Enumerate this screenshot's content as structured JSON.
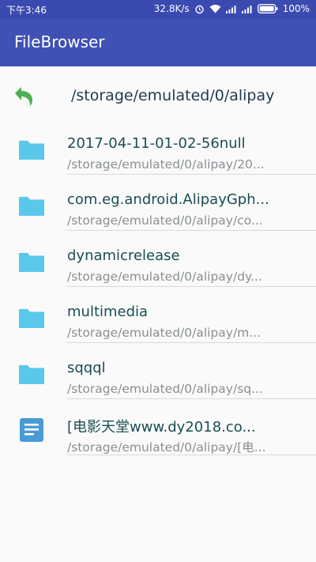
{
  "status_bar": {
    "time": "下午3:46",
    "speed": "32.8K/s",
    "battery": "100%",
    "icons": [
      "alarm-icon",
      "wifi-icon",
      "signal-icon",
      "signal-icon",
      "battery-icon"
    ]
  },
  "app_bar": {
    "title": "FileBrowser",
    "color": "#3f51b5"
  },
  "path_bar": {
    "back_icon": "back-arrow-icon",
    "current_path": "/storage/emulated/0/alipay",
    "back_icon_color": "#4caf50"
  },
  "files": [
    {
      "name": "2017-04-11-01-02-56null",
      "path": "/storage/emulated/0/alipay/20...",
      "type": "folder"
    },
    {
      "name": "com.eg.android.AlipayGph...",
      "path": "/storage/emulated/0/alipay/co...",
      "type": "folder"
    },
    {
      "name": "dynamicrelease",
      "path": "/storage/emulated/0/alipay/dy...",
      "type": "folder"
    },
    {
      "name": "multimedia",
      "path": "/storage/emulated/0/alipay/m...",
      "type": "folder"
    },
    {
      "name": "sqqql",
      "path": "/storage/emulated/0/alipay/sq...",
      "type": "folder"
    },
    {
      "name": "[电影天堂www.dy2018.co...",
      "path": "/storage/emulated/0/alipay/[电...",
      "type": "document"
    }
  ],
  "colors": {
    "folder": "#5ac8eb",
    "document": "#4a9bd4"
  }
}
